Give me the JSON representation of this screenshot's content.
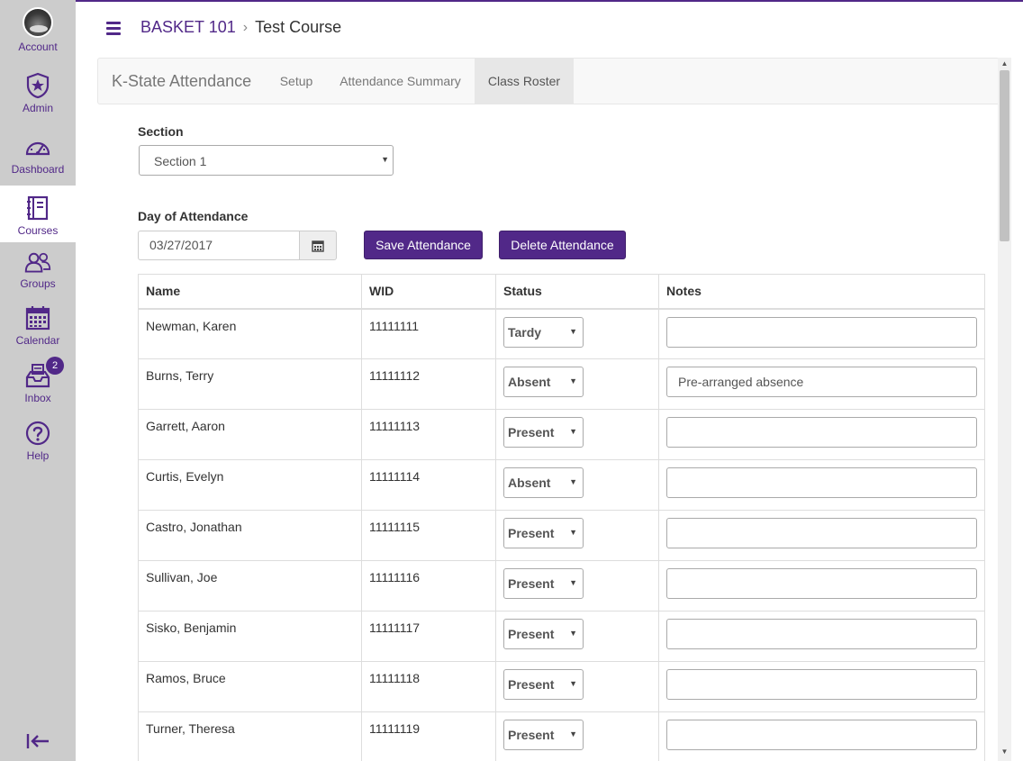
{
  "global_nav": {
    "items": [
      {
        "label": "Account",
        "icon": "avatar"
      },
      {
        "label": "Admin",
        "icon": "shield-star-icon"
      },
      {
        "label": "Dashboard",
        "icon": "speedometer-icon"
      },
      {
        "label": "Courses",
        "icon": "book-icon"
      },
      {
        "label": "Groups",
        "icon": "people-icon"
      },
      {
        "label": "Calendar",
        "icon": "calendar-icon"
      },
      {
        "label": "Inbox",
        "icon": "inbox-icon",
        "badge": "2"
      },
      {
        "label": "Help",
        "icon": "help-icon"
      }
    ],
    "active": "Courses"
  },
  "header": {
    "course_code": "BASKET 101",
    "page_title": "Test Course"
  },
  "tool": {
    "brand": "K-State Attendance",
    "tabs": [
      "Setup",
      "Attendance Summary",
      "Class Roster"
    ],
    "active_tab": "Class Roster"
  },
  "form": {
    "section_label": "Section",
    "section_value": "Section 1",
    "day_label": "Day of Attendance",
    "date_value": "03/27/2017",
    "save_label": "Save Attendance",
    "delete_label": "Delete Attendance"
  },
  "table": {
    "headers": [
      "Name",
      "WID",
      "Status",
      "Notes"
    ],
    "rows": [
      {
        "name": "Newman, Karen",
        "wid": "11111111",
        "status": "Tardy",
        "notes": ""
      },
      {
        "name": "Burns, Terry",
        "wid": "11111112",
        "status": "Absent",
        "notes": "Pre-arranged absence"
      },
      {
        "name": "Garrett, Aaron",
        "wid": "11111113",
        "status": "Present",
        "notes": ""
      },
      {
        "name": "Curtis, Evelyn",
        "wid": "11111114",
        "status": "Absent",
        "notes": ""
      },
      {
        "name": "Castro, Jonathan",
        "wid": "11111115",
        "status": "Present",
        "notes": ""
      },
      {
        "name": "Sullivan, Joe",
        "wid": "11111116",
        "status": "Present",
        "notes": ""
      },
      {
        "name": "Sisko, Benjamin",
        "wid": "11111117",
        "status": "Present",
        "notes": ""
      },
      {
        "name": "Ramos, Bruce",
        "wid": "11111118",
        "status": "Present",
        "notes": ""
      },
      {
        "name": "Turner, Theresa",
        "wid": "11111119",
        "status": "Present",
        "notes": ""
      }
    ]
  },
  "colors": {
    "brand_purple": "#512888",
    "nav_bg": "#cccccc"
  }
}
